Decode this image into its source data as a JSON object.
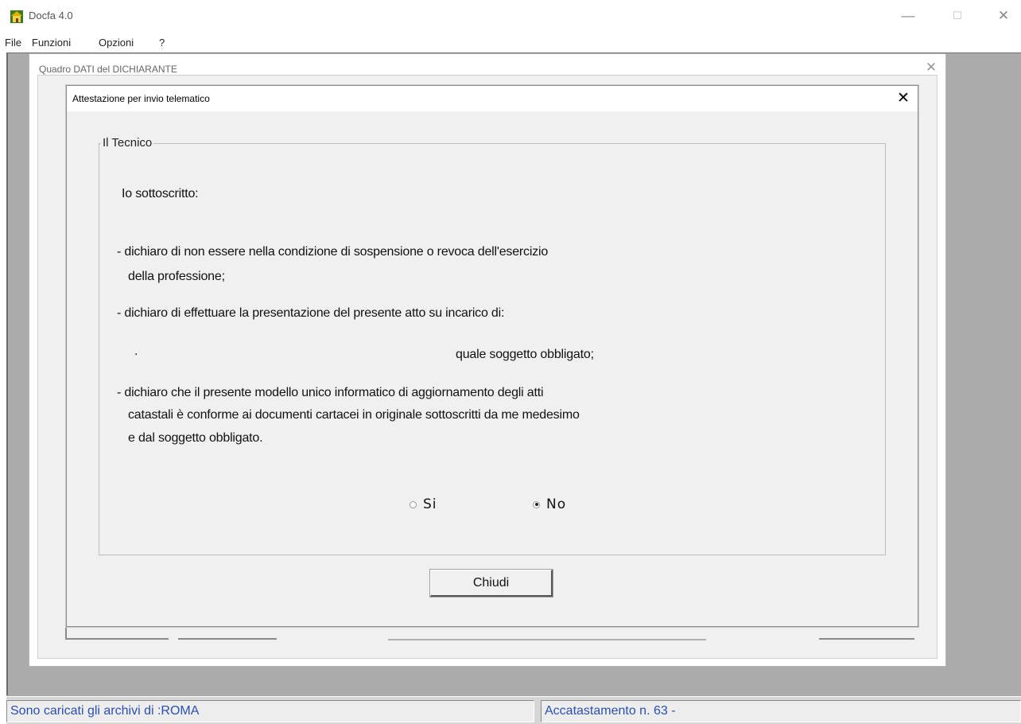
{
  "app": {
    "title": "Docfa 4.0",
    "icon": "house-icon",
    "controls": {
      "minimize": "—",
      "maximize": "☐",
      "close": "✕"
    }
  },
  "menu": {
    "items": [
      "File",
      "Funzioni",
      "Opzioni",
      "?"
    ]
  },
  "child_window": {
    "title": "Quadro DATI del DICHIARANTE",
    "close": "✕"
  },
  "dialog": {
    "title": "Attestazione per invio telematico",
    "close": "✕",
    "group_title": "Il Tecnico",
    "lines": {
      "intro": "Io sottoscritto:",
      "decl1_a": "- dichiaro di non essere nella condizione di sospensione o revoca dell'esercizio",
      "decl1_b": "della professione;",
      "decl2": "- dichiaro di effettuare la presentazione del presente atto su incarico di:",
      "blank_marker": ".",
      "obbligato": "quale soggetto obbligato;",
      "decl3_a": "- dichiaro che il presente modello unico informatico di aggiornamento degli atti",
      "decl3_b": "catastali è conforme ai documenti cartacei in originale sottoscritti da me medesimo",
      "decl3_c": "e dal soggetto obbligato."
    },
    "radio": {
      "options": [
        {
          "label": "Si",
          "checked": false
        },
        {
          "label": "No",
          "checked": true
        }
      ]
    },
    "close_button_label": "Chiudi"
  },
  "statusbar": {
    "left": "Sono caricati gli archivi di :ROMA",
    "right": "Accatastamento n.  63 -"
  },
  "colors": {
    "status_text": "#2b4fb0",
    "mdi_background": "#ababab",
    "dialog_background": "#f0f0f0"
  }
}
